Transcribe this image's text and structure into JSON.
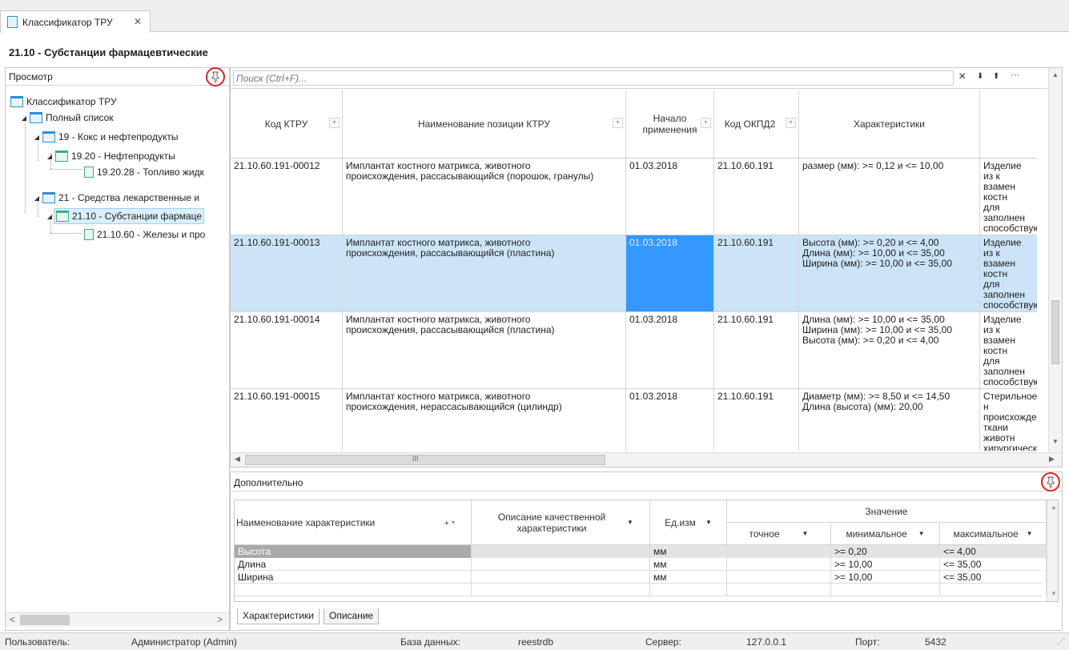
{
  "tab": {
    "label": "Классификатор ТРУ",
    "close": "✕"
  },
  "page_title": "21.10 - Субстанции фармацевтические",
  "left_panel": {
    "title": "Просмотр",
    "tree": [
      {
        "label": "Классификатор ТРУ"
      },
      {
        "label": "Полный список"
      },
      {
        "label": "19 - Кокс и нефтепродукты"
      },
      {
        "label": "19.20 - Нефтепродукты"
      },
      {
        "label": "19.20.28 - Топливо жидк"
      },
      {
        "label": "21 - Средства лекарственные и"
      },
      {
        "label": "21.10 - Субстанции фармаце"
      },
      {
        "label": "21.10.60 - Железы и про"
      }
    ]
  },
  "search": {
    "placeholder": "Поиск (Ctrl+F)...",
    "clear": "×",
    "down": "⬇",
    "up": "⬆",
    "more": "···"
  },
  "grid": {
    "columns": [
      "Код КТРУ",
      "Наименование позиции КТРУ",
      "Начало применения",
      "Код ОКПД2",
      "Характеристики",
      ""
    ],
    "rows": [
      [
        "21.10.60.191-00012",
        "Имплантат костного матрикса, животного\nпроисхождения, рассасывающийся (порошок, гранулы)",
        "01.03.2018",
        "21.10.60.191",
        "размер (мм): >= 0,12 и <= 10,00",
        "Изделие из к\nвзамен костн\nдля заполнен\nспособствую\nнаращиваник\nгубчатой кос"
      ],
      [
        "21.10.60.191-00013",
        "Имплантат костного матрикса, животного\nпроисхождения, рассасывающийся (пластина)",
        "01.03.2018",
        "21.10.60.191",
        "Высота (мм): >= 0,20 и <= 4,00\nДлина (мм): >= 10,00 и <= 35,00\nШирина (мм): >= 10,00 и <= 35,00",
        "Изделие из к\nвзамен костн\nдля заполнен\nспособствую\nнаращиваник\nгубчатой кос"
      ],
      [
        "21.10.60.191-00014",
        "Имплантат костного матрикса, животного\nпроисхождения, рассасывающийся (пластина)",
        "01.03.2018",
        "21.10.60.191",
        "Длина (мм): >= 10,00 и <= 35,00\nШирина (мм): >= 10,00 и <= 35,00\nВысота (мм): >= 0,20 и <= 4,00",
        "Изделие из к\nвзамен костн\nдля заполнен\nспособствую\nнаращиваник\nгубчатой кос"
      ],
      [
        "21.10.60.191-00015",
        "Имплантат костного матрикса, животного\nпроисхождения, нерассасывающийся (цилиндр)",
        "01.03.2018",
        "21.10.60.191",
        "Диаметр (мм): >= 8,50 и <= 14,50\nДлина (высота) (мм): 20,00",
        "Стерильное н\nпроисхожден\nткани животн\nхирургическо\nостеокондукт"
      ]
    ],
    "selected_row": 1,
    "scroll_mid": "III"
  },
  "details": {
    "title": "Дополнительно",
    "headers": {
      "name": "Наименование характеристики",
      "desc": "Описание качественной характеристики",
      "unit": "Ед.изм",
      "value": "Значение",
      "exact": "точное",
      "min": "минимальное",
      "max": "максимальное"
    },
    "rows": [
      {
        "name": "Высота",
        "desc": "",
        "unit": "мм",
        "exact": "",
        "min": ">= 0,20",
        "max": "<= 4,00"
      },
      {
        "name": "Длина",
        "desc": "",
        "unit": "мм",
        "exact": "",
        "min": ">= 10,00",
        "max": "<= 35,00"
      },
      {
        "name": "Ширина",
        "desc": "",
        "unit": "мм",
        "exact": "",
        "min": ">= 10,00",
        "max": "<= 35,00"
      }
    ],
    "tabs": [
      "Характеристики",
      "Описание"
    ]
  },
  "status": {
    "user_label": "Пользователь:",
    "user": "Администратор (Admin)",
    "db_label": "База данных:",
    "db": "reestrdb",
    "server_label": "Сервер:",
    "server": "127.0.0.1",
    "port_label": "Порт:",
    "port": "5432"
  },
  "colors": {
    "selected_row": "#cce4f7",
    "selected_cell": "#3399ff",
    "folder": "#2b8fe0",
    "doc": "#3cae7c",
    "pin_circle": "#e02020"
  }
}
